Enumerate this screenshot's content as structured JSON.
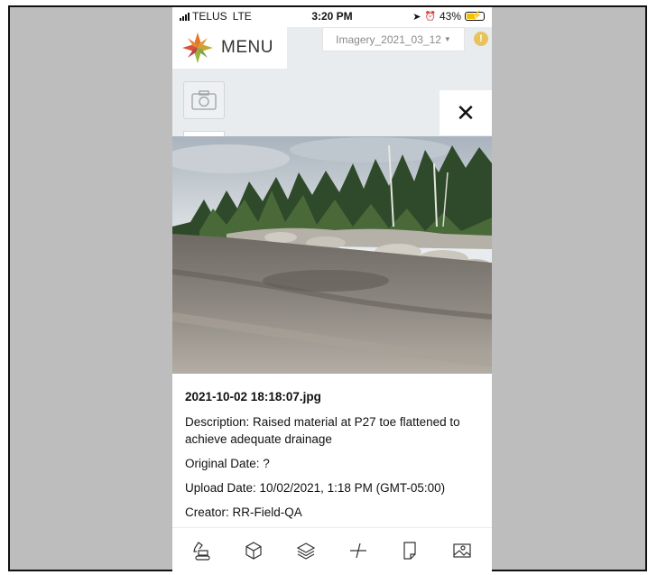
{
  "status_bar": {
    "carrier": "TELUS",
    "network": "LTE",
    "time": "3:20 PM",
    "battery": "43%"
  },
  "header": {
    "menu_label": "MENU",
    "imagery_select": "Imagery_2021_03_12",
    "alert_glyph": "!"
  },
  "photo_detail": {
    "filename": "2021-10-02 18:18:07.jpg",
    "description": "Description: Raised material at P27 toe flattened to achieve adequate drainage",
    "original_date": "Original Date: ?",
    "upload_date": "Upload Date: 10/02/2021, 1:18 PM (GMT-05:00)",
    "creator": "Creator: RR-Field-QA"
  },
  "toolbar": {
    "icons": [
      "excavator-icon",
      "cube-icon",
      "layers-icon",
      "measure-icon",
      "document-icon",
      "image-icon"
    ]
  },
  "colors": {
    "accent_alert": "#e8c25c",
    "background": "#e9ecef"
  }
}
